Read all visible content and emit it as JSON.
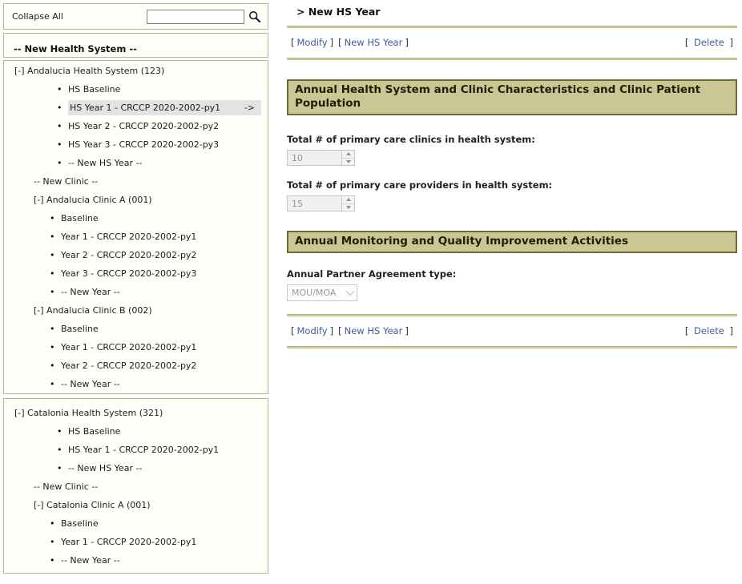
{
  "ui": {
    "lb": "[",
    "rb": "]"
  },
  "colors": {
    "panel_border": "#b7b58a",
    "panel_bg": "#fffffa",
    "section_bar_bg": "#cbc794",
    "section_bar_border": "#6f6b34",
    "separator": "#cbc79b",
    "link": "#3b5c9e",
    "selected_row_bg": "#e3e3e3",
    "disabled_field_bg": "#f0f0f0",
    "disabled_text": "#929292"
  },
  "left_panel": {
    "collapse_all": "Collapse All",
    "search": {
      "value": "",
      "icon": "magnifier-icon"
    },
    "new_health_system": "-- New Health System --",
    "andalucia": {
      "items": [
        {
          "text": "[-] Andalucia Health System (123)"
        },
        {
          "text": "HS Baseline"
        },
        {
          "text": "HS Year 1 - CRCCP 2020-2002-py1",
          "selected": true,
          "arrow": "->"
        },
        {
          "text": "HS Year 2 - CRCCP 2020-2002-py2"
        },
        {
          "text": "HS Year 3 - CRCCP 2020-2002-py3"
        },
        {
          "text": "-- New HS Year --"
        },
        {
          "text": "-- New Clinic --"
        },
        {
          "text": "[-] Andalucia Clinic A (001)"
        },
        {
          "text": "Baseline"
        },
        {
          "text": "Year 1 - CRCCP 2020-2002-py1"
        },
        {
          "text": "Year 2 - CRCCP 2020-2002-py2"
        },
        {
          "text": "Year 3 - CRCCP 2020-2002-py3"
        },
        {
          "text": "-- New Year --"
        },
        {
          "text": "[-] Andalucia Clinic B (002)"
        },
        {
          "text": "Baseline"
        },
        {
          "text": "Year 1 - CRCCP 2020-2002-py1"
        },
        {
          "text": "Year 2 - CRCCP 2020-2002-py2"
        },
        {
          "text": "-- New Year --"
        }
      ]
    },
    "catalonia": {
      "items": [
        {
          "text": "[-] Catalonia Health System (321)"
        },
        {
          "text": "HS Baseline"
        },
        {
          "text": "HS Year 1 - CRCCP 2020-2002-py1"
        },
        {
          "text": "-- New HS Year --"
        },
        {
          "text": "-- New Clinic --"
        },
        {
          "text": "[-] Catalonia Clinic A (001)"
        },
        {
          "text": "Baseline"
        },
        {
          "text": "Year 1 - CRCCP 2020-2002-py1"
        },
        {
          "text": "-- New Year --"
        }
      ]
    }
  },
  "right_panel": {
    "title": "> New HS Year",
    "top_actions": {
      "modify": "Modify",
      "new_hs_year": "New HS Year",
      "delete": "Delete"
    },
    "bottom_actions": {
      "modify": "Modify",
      "new_hs_year": "New HS Year",
      "delete": "Delete"
    },
    "sections": [
      {
        "heading": "Annual Health System and Clinic Characteristics and Clinic Patient Population",
        "fields": [
          {
            "label": "Total # of primary care clinics in health system:",
            "value": "10",
            "control": "number-stepper",
            "disabled": true
          },
          {
            "label": "Total # of primary care providers in health system:",
            "value": "15",
            "control": "number-stepper",
            "disabled": true
          }
        ]
      },
      {
        "heading": "Annual Monitoring and Quality Improvement Activities",
        "fields": [
          {
            "label": "Annual Partner Agreement type:",
            "value": "MOU/MOA",
            "control": "select",
            "disabled": true
          }
        ]
      }
    ]
  }
}
